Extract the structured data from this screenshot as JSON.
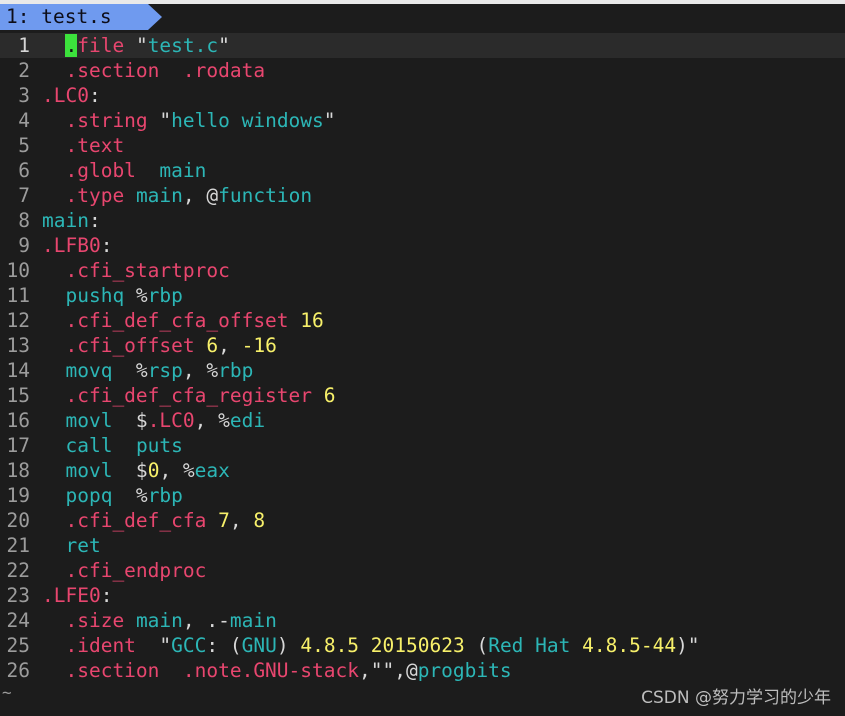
{
  "tab": {
    "label": "1: test.s"
  },
  "watermark": "CSDN @努力学习的少年",
  "colors": {
    "background": "#1c1c1c",
    "tab": "#6f9aef",
    "directive": "#e8466f",
    "keyword": "#2cb6b6",
    "number": "#f7f06a",
    "cursor": "#3ce23c"
  },
  "lines": [
    [
      [
        "dir",
        "  "
      ],
      [
        "cur",
        "."
      ],
      [
        "dir",
        "file"
      ],
      [
        "txt",
        " \""
      ],
      [
        "ins",
        "test.c"
      ],
      [
        "txt",
        "\""
      ]
    ],
    [
      [
        "dir",
        "  .section  .rodata"
      ]
    ],
    [
      [
        "lbl",
        ".LC0"
      ],
      [
        "txt",
        ":"
      ]
    ],
    [
      [
        "dir",
        "  .string"
      ],
      [
        "txt",
        " \""
      ],
      [
        "ins",
        "hello windows"
      ],
      [
        "txt",
        "\""
      ]
    ],
    [
      [
        "dir",
        "  .text"
      ]
    ],
    [
      [
        "dir",
        "  .globl"
      ],
      [
        "txt",
        "  "
      ],
      [
        "ins",
        "main"
      ]
    ],
    [
      [
        "dir",
        "  .type"
      ],
      [
        "txt",
        " "
      ],
      [
        "ins",
        "main"
      ],
      [
        "txt",
        ", @"
      ],
      [
        "ins",
        "function"
      ]
    ],
    [
      [
        "ins",
        "main"
      ],
      [
        "txt",
        ":"
      ]
    ],
    [
      [
        "lbl",
        ".LFB0"
      ],
      [
        "txt",
        ":"
      ]
    ],
    [
      [
        "dir",
        "  .cfi_startproc"
      ]
    ],
    [
      [
        "ins",
        "  pushq"
      ],
      [
        "txt",
        " %"
      ],
      [
        "reg",
        "rbp"
      ]
    ],
    [
      [
        "dir",
        "  .cfi_def_cfa_offset"
      ],
      [
        "txt",
        " "
      ],
      [
        "num",
        "16"
      ]
    ],
    [
      [
        "dir",
        "  .cfi_offset"
      ],
      [
        "txt",
        " "
      ],
      [
        "num",
        "6"
      ],
      [
        "txt",
        ", "
      ],
      [
        "num",
        "-16"
      ]
    ],
    [
      [
        "ins",
        "  movq"
      ],
      [
        "txt",
        "  %"
      ],
      [
        "reg",
        "rsp"
      ],
      [
        "txt",
        ", %"
      ],
      [
        "reg",
        "rbp"
      ]
    ],
    [
      [
        "dir",
        "  .cfi_def_cfa_register"
      ],
      [
        "txt",
        " "
      ],
      [
        "num",
        "6"
      ]
    ],
    [
      [
        "ins",
        "  movl"
      ],
      [
        "txt",
        "  $"
      ],
      [
        "lbl",
        ".LC0"
      ],
      [
        "txt",
        ", %"
      ],
      [
        "reg",
        "edi"
      ]
    ],
    [
      [
        "ins",
        "  call"
      ],
      [
        "txt",
        "  "
      ],
      [
        "ins",
        "puts"
      ]
    ],
    [
      [
        "ins",
        "  movl"
      ],
      [
        "txt",
        "  $"
      ],
      [
        "num",
        "0"
      ],
      [
        "txt",
        ", %"
      ],
      [
        "reg",
        "eax"
      ]
    ],
    [
      [
        "ins",
        "  popq"
      ],
      [
        "txt",
        "  %"
      ],
      [
        "reg",
        "rbp"
      ]
    ],
    [
      [
        "dir",
        "  .cfi_def_cfa"
      ],
      [
        "txt",
        " "
      ],
      [
        "num",
        "7"
      ],
      [
        "txt",
        ", "
      ],
      [
        "num",
        "8"
      ]
    ],
    [
      [
        "ins",
        "  ret"
      ]
    ],
    [
      [
        "dir",
        "  .cfi_endproc"
      ]
    ],
    [
      [
        "lbl",
        ".LFE0"
      ],
      [
        "txt",
        ":"
      ]
    ],
    [
      [
        "dir",
        "  .size"
      ],
      [
        "txt",
        " "
      ],
      [
        "ins",
        "main"
      ],
      [
        "txt",
        ", .-"
      ],
      [
        "ins",
        "main"
      ]
    ],
    [
      [
        "dir",
        "  .ident"
      ],
      [
        "txt",
        "  \""
      ],
      [
        "ins",
        "GCC"
      ],
      [
        "txt",
        ": ("
      ],
      [
        "ins",
        "GNU"
      ],
      [
        "txt",
        ") "
      ],
      [
        "num",
        "4.8.5 20150623"
      ],
      [
        "txt",
        " ("
      ],
      [
        "ins",
        "Red Hat"
      ],
      [
        "txt",
        " "
      ],
      [
        "num",
        "4.8.5-44"
      ],
      [
        "txt",
        ")\""
      ]
    ],
    [
      [
        "dir",
        "  .section  .note.GNU-stack"
      ],
      [
        "txt",
        ",\"\",@"
      ],
      [
        "ins",
        "progbits"
      ]
    ]
  ],
  "tilde": "~"
}
